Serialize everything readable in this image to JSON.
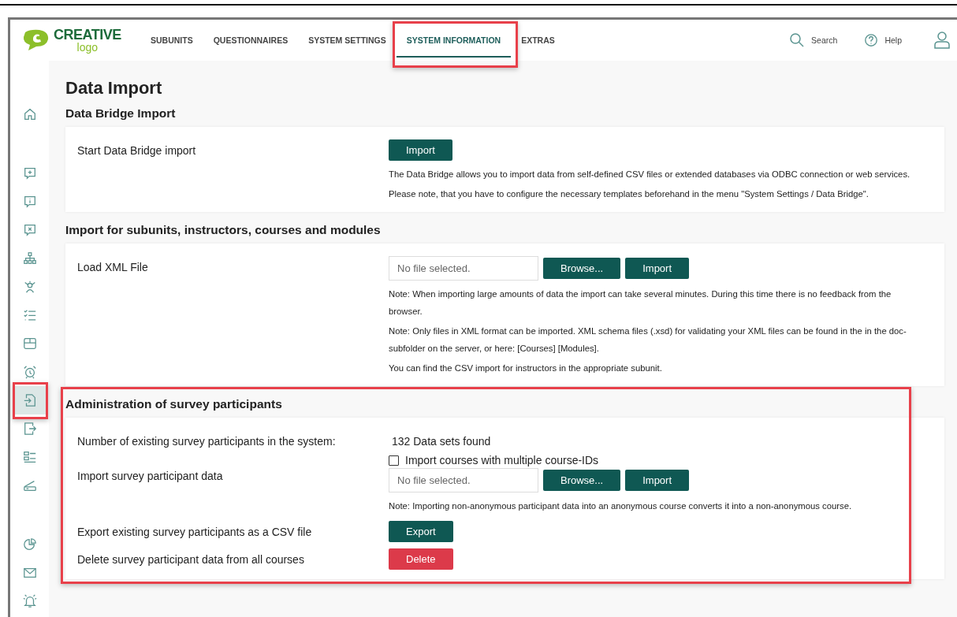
{
  "header": {
    "logo": {
      "word": "CREATIVE",
      "sub": "logo"
    },
    "tabs": [
      {
        "label": "SUBUNITS",
        "selected": false,
        "highlighted": false
      },
      {
        "label": "QUESTIONNAIRES",
        "selected": false,
        "highlighted": false
      },
      {
        "label": "SYSTEM SETTINGS",
        "selected": false,
        "highlighted": false
      },
      {
        "label": "SYSTEM INFORMATION",
        "selected": true,
        "highlighted": true
      },
      {
        "label": "EXTRAS",
        "selected": false,
        "highlighted": false
      }
    ],
    "search": "Search",
    "help": "Help"
  },
  "sidebar": {
    "groups": [
      [
        {
          "kind": "home",
          "selected": false,
          "highlighted": false
        }
      ],
      [
        {
          "kind": "chat-plus",
          "selected": false,
          "highlighted": false
        },
        {
          "kind": "chat-info",
          "selected": false,
          "highlighted": false
        },
        {
          "kind": "chat-x",
          "selected": false,
          "highlighted": false
        },
        {
          "kind": "hierarchy",
          "selected": false,
          "highlighted": false
        },
        {
          "kind": "people",
          "selected": false,
          "highlighted": false
        },
        {
          "kind": "checklist",
          "selected": false,
          "highlighted": false
        },
        {
          "kind": "box",
          "selected": false,
          "highlighted": false
        },
        {
          "kind": "alarm",
          "selected": false,
          "highlighted": false
        },
        {
          "kind": "file-import",
          "selected": true,
          "highlighted": true
        },
        {
          "kind": "file-export",
          "selected": false,
          "highlighted": false
        },
        {
          "kind": "list",
          "selected": false,
          "highlighted": false
        },
        {
          "kind": "scanner",
          "selected": false,
          "highlighted": false
        }
      ],
      [
        {
          "kind": "pie",
          "selected": false,
          "highlighted": false
        },
        {
          "kind": "mail",
          "selected": false,
          "highlighted": false
        },
        {
          "kind": "bell",
          "selected": false,
          "highlighted": false
        }
      ]
    ]
  },
  "page": {
    "title": "Data Import",
    "sections": [
      {
        "heading": "Data Bridge Import",
        "highlighted": false,
        "rows": [
          {
            "label": "Start Data Bridge import",
            "items": [
              {
                "kind": "button",
                "label": "Import"
              },
              {
                "kind": "note",
                "text": "The Data Bridge allows you to import data from self-defined CSV files or extended databases via ODBC connection or web services."
              },
              {
                "kind": "note",
                "text": "Please note, that you have to configure the necessary templates beforehand in the menu \"System Settings / Data Bridge\"."
              }
            ]
          }
        ]
      },
      {
        "heading": "Import for subunits, instructors, courses and modules",
        "highlighted": false,
        "rows": [
          {
            "label": "Load XML File",
            "items": [
              {
                "kind": "file",
                "placeholder": "No file selected.",
                "buttons": [
                  "Browse...",
                  "Import"
                ]
              },
              {
                "kind": "note",
                "text": "Note: When importing large amounts of data the import can take several minutes. During this time there is no feedback from the browser."
              },
              {
                "kind": "note",
                "text": "Note: Only files in XML format can be imported. XML schema files (.xsd) for validating your XML files can be found in the in the doc-subfolder on the server, or here: [Courses] [Modules]."
              },
              {
                "kind": "note",
                "text": "You can find the CSV import for instructors in the appropriate subunit."
              }
            ]
          }
        ]
      },
      {
        "heading": "Administration of survey participants",
        "highlighted": true,
        "rows": [
          {
            "label": "Number of existing survey participants in the system:",
            "items": [
              {
                "kind": "text",
                "text": "132 Data sets found"
              }
            ]
          },
          {
            "label": "Import survey participant data",
            "items": [
              {
                "kind": "checkbox",
                "label": "Import courses with multiple course-IDs",
                "checked": false
              },
              {
                "kind": "file",
                "placeholder": "No file selected.",
                "buttons": [
                  "Browse...",
                  "Import"
                ]
              },
              {
                "kind": "note",
                "text": "Note: Importing non-anonymous participant data into an anonymous course converts it into a non-anonymous course."
              }
            ]
          },
          {
            "label": "Export existing survey participants as a CSV file",
            "items": [
              {
                "kind": "button",
                "label": "Export"
              }
            ]
          },
          {
            "label": "Delete survey participant data from all courses",
            "items": [
              {
                "kind": "danger-button",
                "label": "Delete"
              }
            ]
          }
        ]
      }
    ]
  }
}
